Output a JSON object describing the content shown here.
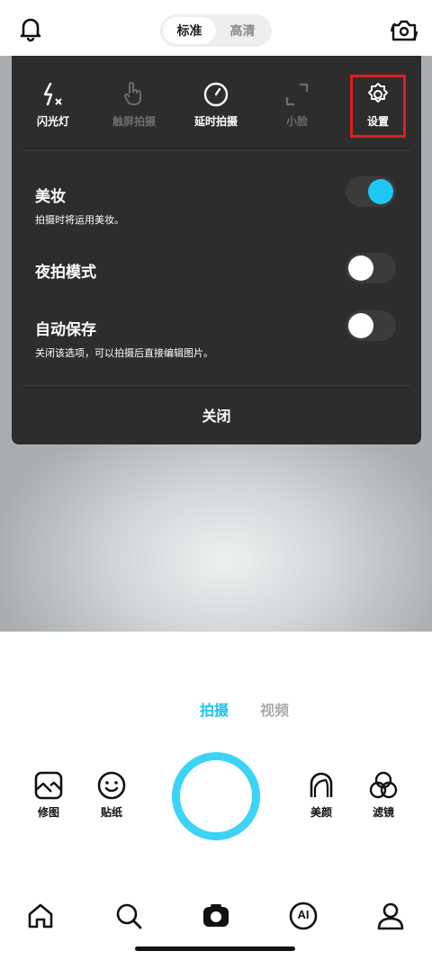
{
  "header": {
    "quality_options": [
      "标准",
      "高清"
    ],
    "selected_quality": "标准"
  },
  "panel": {
    "tools": [
      {
        "label": "闪光灯",
        "icon": "flash-auto-icon",
        "enabled": true
      },
      {
        "label": "触屏拍摄",
        "icon": "touch-hand-icon",
        "enabled": false
      },
      {
        "label": "延时拍摄",
        "icon": "timer-icon",
        "enabled": true
      },
      {
        "label": "小脸",
        "icon": "expand-corners-icon",
        "enabled": false
      },
      {
        "label": "设置",
        "icon": "gear-icon",
        "enabled": true
      }
    ],
    "settings": [
      {
        "title": "美妆",
        "description": "拍摄时将运用美妆。",
        "on": true
      },
      {
        "title": "夜拍模式",
        "description": "",
        "on": false
      },
      {
        "title": "自动保存",
        "description": "关闭该选项，可以拍摄后直接编辑图片。",
        "on": false
      }
    ],
    "close_label": "关闭"
  },
  "modes": [
    "拍摄",
    "视频"
  ],
  "selected_mode": "拍摄",
  "shortcuts": {
    "left": [
      {
        "label": "修图",
        "icon": "image-edit-icon"
      },
      {
        "label": "贴纸",
        "icon": "smiley-sticker-icon"
      }
    ],
    "right": [
      {
        "label": "美颜",
        "icon": "face-outline-icon"
      },
      {
        "label": "滤镜",
        "icon": "filter-circles-icon"
      }
    ]
  },
  "nav": {
    "items": [
      {
        "icon": "home-icon"
      },
      {
        "icon": "search-icon"
      },
      {
        "icon": "camera-icon",
        "active": true
      },
      {
        "icon": "ai-icon",
        "text": "AI"
      },
      {
        "icon": "profile-icon"
      }
    ]
  },
  "colors": {
    "accent": "#1fc2ef",
    "panel_bg": "#2d2d2d",
    "highlight_border": "#e31b1b"
  }
}
